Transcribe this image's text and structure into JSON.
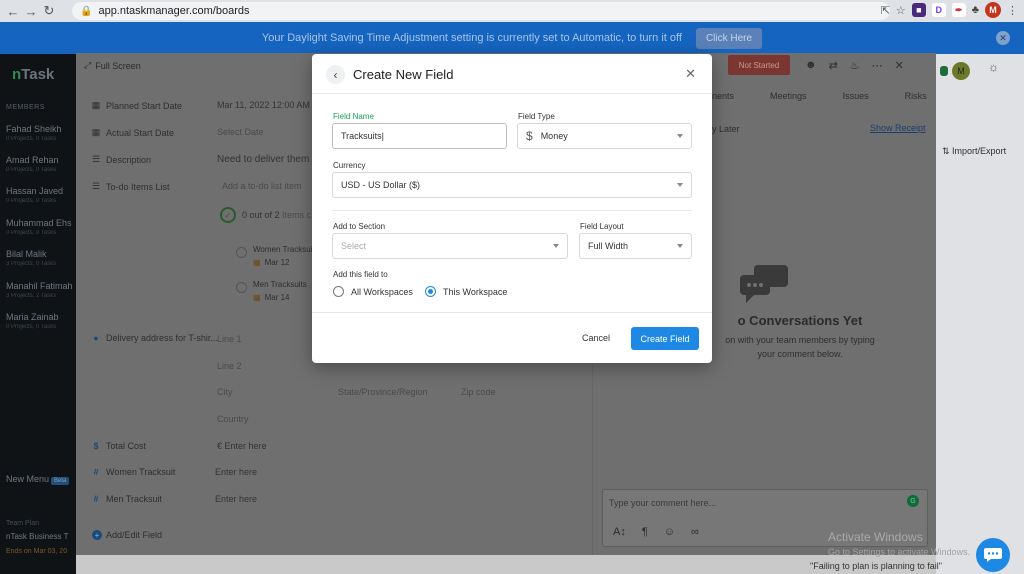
{
  "browser": {
    "url": "app.ntaskmanager.com/boards"
  },
  "banner": {
    "message": "Your Daylight Saving Time Adjustment setting is currently set to Automatic, to turn it off",
    "button": "Click Here"
  },
  "sidebar": {
    "logo_n": "n",
    "logo_task": "Task",
    "members_title": "MEMBERS",
    "members": [
      {
        "name": "Fahad Sheikh",
        "projects": "0 Projects, 0 Tasks"
      },
      {
        "name": "Amad Rehan",
        "projects": "0 Projects, 0 Tasks"
      },
      {
        "name": "Hassan Javed",
        "projects": "0 Projects, 0 Tasks"
      },
      {
        "name": "Muhammad Ehs",
        "projects": "0 Projects, 0 Tasks"
      },
      {
        "name": "Bilal Malik",
        "projects": "3 Projects, 0 Tasks"
      },
      {
        "name": "Manahil Fatimah",
        "projects": "3 Projects, 2 Tasks"
      },
      {
        "name": "Maria Zainab",
        "projects": "0 Projects, 0 Tasks"
      }
    ],
    "new_menu": "New Menu",
    "beta": "Beta",
    "team_plan": "Team Plan",
    "plan_name": "nTask Business T",
    "plan_end": "Ends on Mar 03, 20"
  },
  "task": {
    "fullscreen": "Full Screen",
    "planned_start_label": "Planned Start Date",
    "planned_start_value": "Mar 11, 2022 12:00 AM",
    "actual_start_label": "Actual Start Date",
    "actual_start_value": "Select Date",
    "description_label": "Description",
    "description_value": "Need to deliver them A",
    "todo_label": "To-do Items List",
    "todo_add": "Add a to-do list item",
    "todo_progress": "0 out of 2",
    "todo_items_word": "Items c",
    "todo_items": [
      {
        "title": "Women Tracksuit",
        "date": "Mar 12"
      },
      {
        "title": "Men Tracksuits",
        "date": "Mar 14"
      }
    ],
    "delivery_label": "Delivery address for T-shir...",
    "line1": "Line 1",
    "line2": "Line 2",
    "city": "City",
    "state": "State/Province/Region",
    "zip": "Zip code",
    "country": "Country",
    "total_cost_label": "Total Cost",
    "total_cost_value": "€  Enter here",
    "women_label": "Women Tracksuit",
    "women_value": "Enter here",
    "men_label": "Men Tracksuit",
    "men_value": "Enter here",
    "add_edit": "Add/Edit Field",
    "status": "Not Started",
    "tabs": [
      "nents",
      "Meetings",
      "Issues",
      "Risks"
    ],
    "later": "y Later",
    "show_receipt": "Show Receipt",
    "import_export": "Import/Export",
    "no_conv_title": "o Conversations Yet",
    "no_conv_sub1": "on with your team members by typing",
    "no_conv_sub2": "your comment below.",
    "comment_placeholder": "Type your comment here...",
    "user_initial": "M",
    "quote": "\"Failing to plan is planning to fail\""
  },
  "modal": {
    "title": "Create New Field",
    "field_name_label": "Field Name",
    "field_name_value": "Tracksuits",
    "field_type_label": "Field Type",
    "field_type_value": "Money",
    "currency_label": "Currency",
    "currency_value": "USD - US Dollar ($)",
    "section_label": "Add to Section",
    "section_placeholder": "Select",
    "layout_label": "Field Layout",
    "layout_value": "Full Width",
    "scope_label": "Add this field to",
    "scope_all": "All Workspaces",
    "scope_this": "This Workspace",
    "cancel": "Cancel",
    "create": "Create Field"
  },
  "windows": {
    "activate": "Activate Windows",
    "activate_sub": "Go to Settings to activate Windows."
  },
  "colors": {
    "accent": "#1e88e5",
    "banner": "#1565c0",
    "active_label": "#1aa05a",
    "status_red": "#d9473d"
  }
}
